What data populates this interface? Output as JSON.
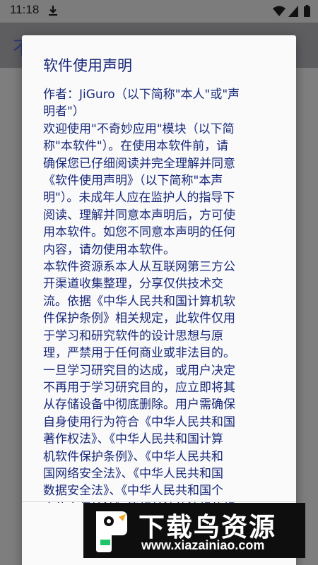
{
  "status_bar": {
    "time": "11:18",
    "icons": [
      "download-icon",
      "wifi-icon",
      "signal-icon",
      "battery-icon"
    ]
  },
  "app_bar": {
    "title_partial": "不"
  },
  "dialog": {
    "title": "软件使用声明",
    "lines": [
      "作者：JiGuro（以下简称\"本人\"或\"声",
      "明者\"）",
      "欢迎使用\"不奇妙应用\"模块（以下简",
      "称\"本软件\"）。在使用本软件前，请",
      "确保您已仔细阅读并完全理解并同意",
      "《软件使用声明》（以下简称\"本声",
      "明\"）。未成年人应在监护人的指导下",
      "阅读、理解并同意本声明后，方可使",
      "用本软件。如您不同意本声明的任何",
      "内容，请勿使用本软件。",
      "本软件资源系本人从互联网第三方公",
      "开渠道收集整理，分享仅供技术交",
      "流。依据《中华人民共和国计算机软",
      "件保护条例》相关规定，此软件仅用",
      "于学习和研究软件的设计思想与原",
      "理，严禁用于任何商业或非法目的。",
      "一旦学习研究目的达成，或用户决定",
      "不再用于学习研究目的，应立即将其",
      "从存储设备中彻底删除。用户需确保",
      "自身使用行为符合《中华人民共和国",
      "著作权法》、《中华人民共和国计算",
      "机软件保护条例》、《中华人民共和",
      "国网络安全法》、《中华人民共和国",
      "数据安全法》、《中华人民共和国个",
      "人信息保护法》等相关法律法规的规"
    ]
  },
  "watermark": {
    "text": "下载鸟资源",
    "url": "www.xiazainiao.com"
  },
  "colors": {
    "dialog_text": "#1a2a7a",
    "dialog_bg": "#fafafa",
    "scrim": "#7b7b7b",
    "watermark_bg": "#0e0e0e"
  }
}
